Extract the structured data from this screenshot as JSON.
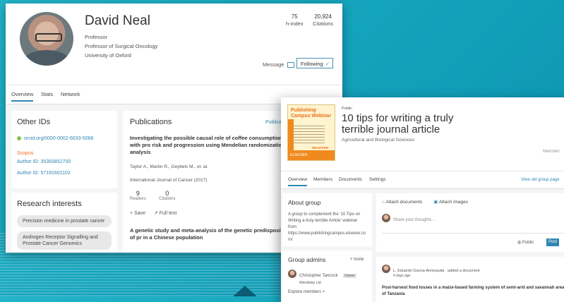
{
  "profile": {
    "name": "David Neal",
    "lines": [
      "Professor",
      "Professor of Surgical Oncology",
      "University of Oxford"
    ],
    "metrics": [
      {
        "value": "75",
        "label": "h-index"
      },
      {
        "value": "20,924",
        "label": "Citations"
      }
    ],
    "message_label": "Message",
    "following_label": "Following",
    "tabs": [
      "Overview",
      "Stats",
      "Network"
    ],
    "other_ids": {
      "title": "Other IDs",
      "orcid": "orcid.org/0000-0002-6033-5086",
      "scopus_label": "Scopus",
      "author_ids": [
        "Author ID: 35393852700",
        "Author ID: 57191601102"
      ]
    },
    "research": {
      "title": "Research interests",
      "chips": [
        "Precision medicine in prostate cancer",
        "Androgen Receptor Signalling and Prostate Cancer Genomics"
      ]
    },
    "publications": {
      "title": "Publications",
      "right_link": "Publicat",
      "item1": {
        "title": "Investigating the possible causal role of coffee consumption with pro risk and progression using Mendelian randomization analysis",
        "authors": "Taylor A., Martin R., Geybels M., et. al.",
        "journal": "International Journal of Cancer (2017)",
        "readers": "9",
        "readers_label": "Readers",
        "citations": "0",
        "citations_label": "Citations",
        "save_label": "+ Save",
        "fulltext_label": "↗ Full text"
      },
      "item2_title": "A genetic study and meta-analysis of the genetic predisposition of pr in a Chinese population"
    }
  },
  "group": {
    "thumb_title": "Publishing Campus Webinar",
    "thumb_bar": "ELSEVIER",
    "thumb_register": "REGISTER",
    "public_label": "Public",
    "title": "10 tips for writing a truly terrible journal article",
    "subtitle": "Agricultural and Biological Sciences",
    "member_label": "Member",
    "tabs": [
      "Overview",
      "Members",
      "Documents",
      "Settings"
    ],
    "old_view": "View old group page",
    "about": {
      "title": "About group",
      "text": "A group to complement the '10 Tips on Writing a truly terrible Article' webinar from https://www.publishingcampus.elsevier.co m/"
    },
    "admins": {
      "title": "Group admins",
      "invite": "+ Invite",
      "admin_name": "Christopher Tancock",
      "admin_badge": "Owner",
      "admin_org": "Wendelay Ltd",
      "explore": "Explore members >"
    },
    "composer": {
      "attach_docs": "Attach documents",
      "attach_images": "Attach images",
      "placeholder": "Share your thoughts...",
      "visibility": "Public",
      "post": "Post"
    },
    "feed": {
      "author": "L. Eduardo Garcia-Amezquita",
      "action": "added a document",
      "time": "4 days ago",
      "doc_title": "Post-harvest food losses in a maize-based farming system of semi-arid and savannah area of Tanzania"
    }
  },
  "colors": {
    "background": "#14a3bc",
    "accent": "#2f86b3",
    "orange": "#e9711c"
  }
}
